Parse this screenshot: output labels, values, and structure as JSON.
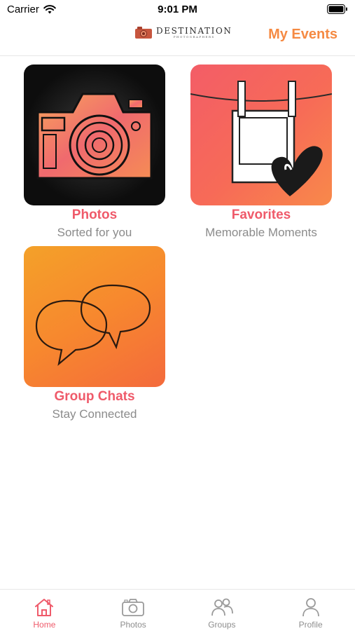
{
  "status_bar": {
    "carrier": "Carrier",
    "time": "9:01 PM"
  },
  "header": {
    "logo_text": "DESTINATION",
    "logo_subtext": "PHOTOGRAPHERS",
    "action_label": "My Events"
  },
  "tiles": [
    {
      "title": "Photos",
      "subtitle": "Sorted for you",
      "icon": "camera-icon"
    },
    {
      "title": "Favorites",
      "subtitle": "Memorable Moments",
      "icon": "polaroid-heart-icon"
    },
    {
      "title": "Group Chats",
      "subtitle": "Stay Connected",
      "icon": "chat-bubbles-icon"
    }
  ],
  "tab_bar": {
    "active": "Home",
    "items": [
      {
        "label": "Home",
        "icon": "home-icon"
      },
      {
        "label": "Photos",
        "icon": "camera-icon"
      },
      {
        "label": "Groups",
        "icon": "people-icon"
      },
      {
        "label": "Profile",
        "icon": "person-icon"
      }
    ]
  },
  "colors": {
    "accent_pink": "#ef5a6a",
    "accent_orange": "#f58a43",
    "muted_text": "#8b8b8b"
  }
}
